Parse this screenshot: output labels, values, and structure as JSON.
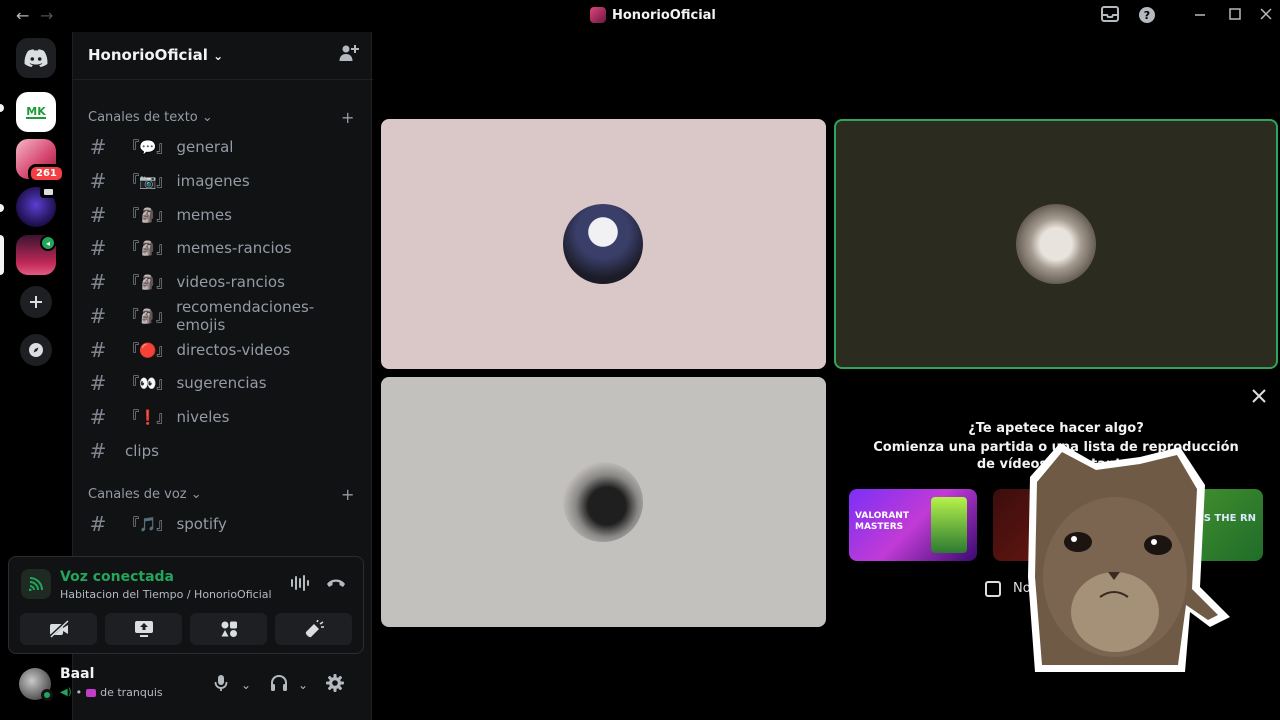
{
  "titlebar": {
    "title": "HonorioOficial",
    "back_icon": "←",
    "forward_icon": "→"
  },
  "rail": {
    "mention_count": "261"
  },
  "server": {
    "name": "HonorioOficial",
    "chevron": "⌄"
  },
  "categories": {
    "text": "Canales de texto ⌄",
    "voice": "Canales de voz ⌄"
  },
  "channels": [
    {
      "deco": "『💬』",
      "name": "general"
    },
    {
      "deco": "『📷』",
      "name": "imagenes"
    },
    {
      "deco": "『🗿』",
      "name": "memes"
    },
    {
      "deco": "『🗿』",
      "name": "memes-rancios"
    },
    {
      "deco": "『🗿』",
      "name": "videos-rancios"
    },
    {
      "deco": "『🗿』",
      "name": "recomendaciones-emojis"
    },
    {
      "deco": "『🔴』",
      "name": "directos-videos"
    },
    {
      "deco": "『👀』",
      "name": "sugerencias"
    },
    {
      "deco": "『❗』",
      "name": "niveles"
    },
    {
      "deco": "",
      "name": "clips"
    }
  ],
  "voice_channels": [
    {
      "deco": "『🎵』",
      "name": "spotify"
    }
  ],
  "voice_panel": {
    "title": "Voz conectada",
    "subtitle": "Habitacion del Tiempo / HonorioOficial"
  },
  "user": {
    "name": "Baal",
    "status": "de tranquis"
  },
  "activity": {
    "title": "¿Te apetece hacer algo?",
    "subtitle": "Comienza una partida o una lista de reproducción de vídeos al instante.",
    "checkbox_label": "No",
    "cards": [
      {
        "text": "VALORANT MASTERS"
      },
      {
        "text": "S"
      },
      {
        "text": "SS THE RN"
      }
    ]
  },
  "colors": {
    "accent_green": "#23a55a",
    "danger_red": "#f23f43",
    "tile_pink": "#dac8c8",
    "tile_olive": "#2c2b20",
    "tile_gray": "#c2c1bd"
  }
}
